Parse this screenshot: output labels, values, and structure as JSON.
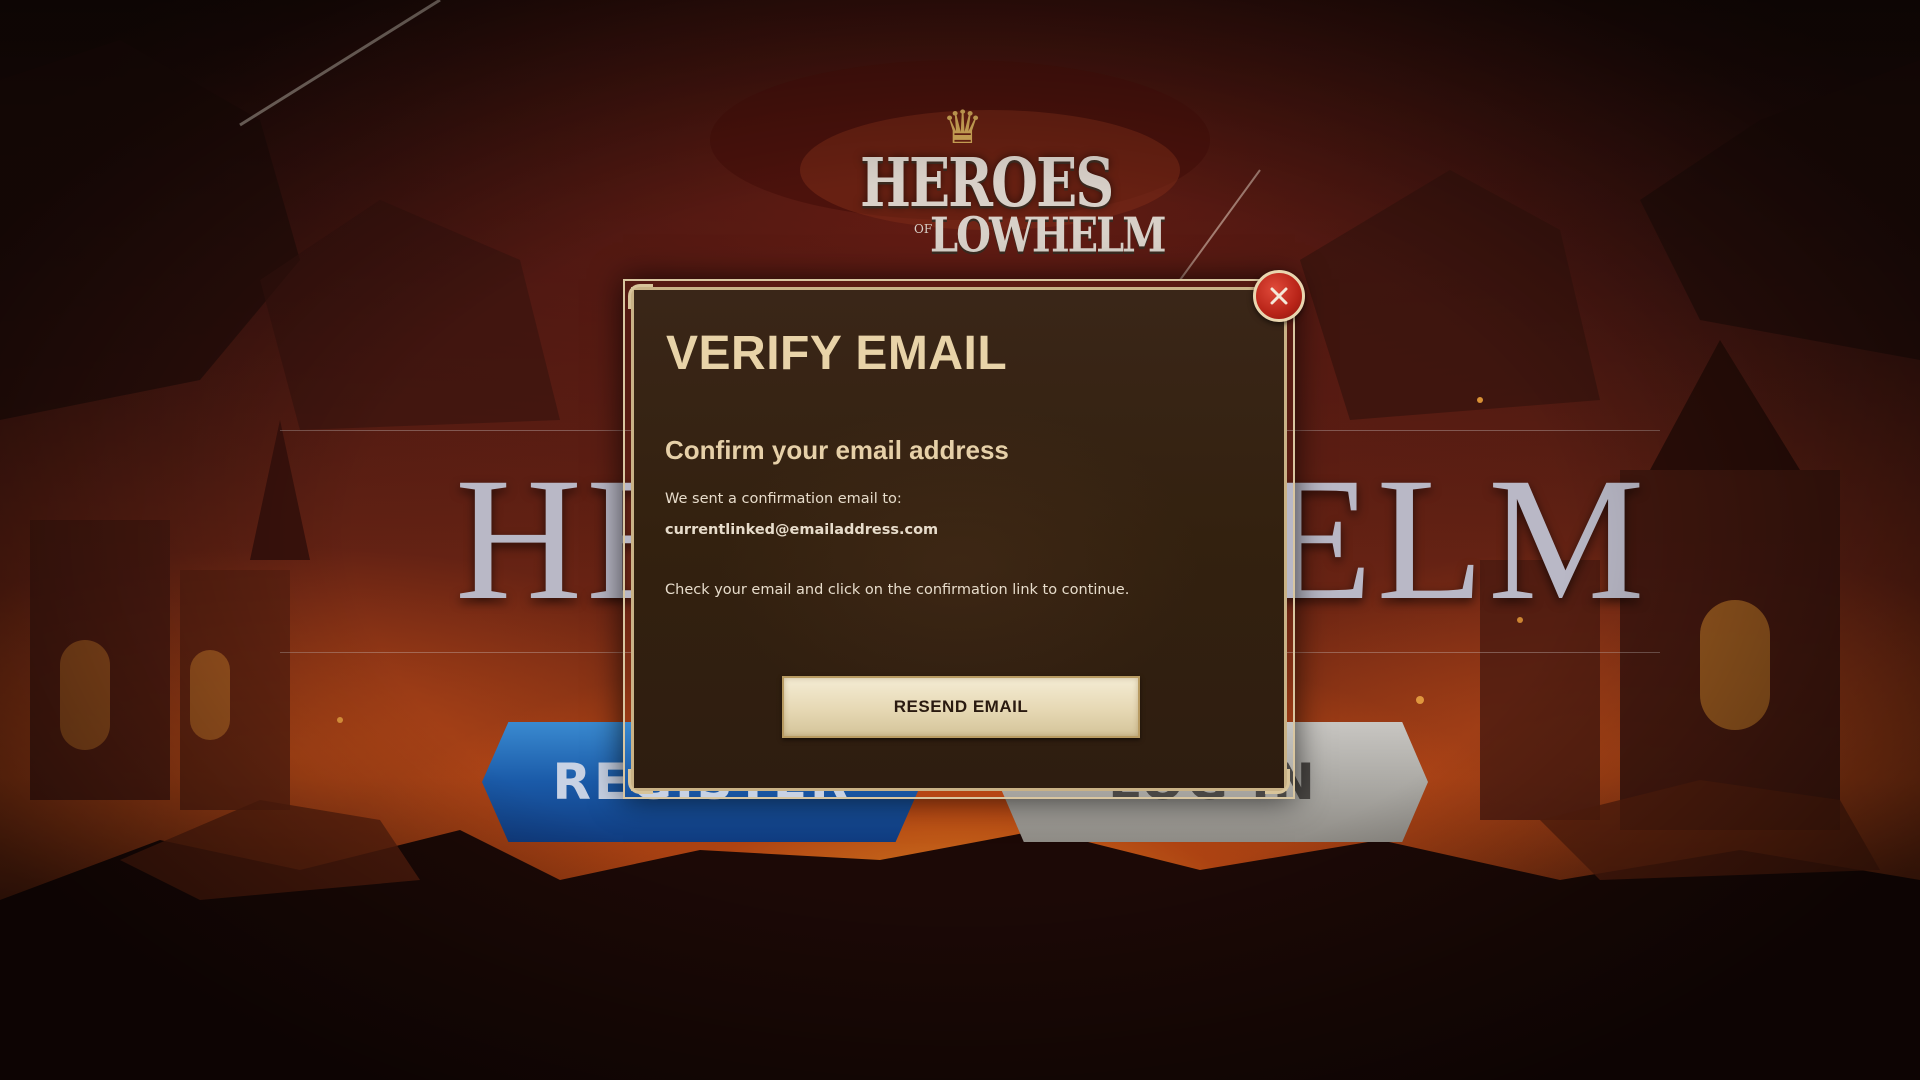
{
  "game": {
    "logo_line1": "HEROES",
    "logo_of": "OF",
    "logo_line2": "LOWHELM",
    "background_title_left": "HER",
    "background_title_right": "ELM"
  },
  "background_buttons": {
    "register_label": "REGISTER",
    "login_label": "LOG IN"
  },
  "modal": {
    "title": "VERIFY EMAIL",
    "subtitle": "Confirm your email address",
    "sent_text": "We sent a confirmation email to:",
    "email": "currentlinked@emailaddress.com",
    "instructions": "Check your email and click on the confirmation link to continue.",
    "resend_label": "RESEND EMAIL",
    "close_icon": "close-icon"
  },
  "colors": {
    "modal_bg": "#33210f",
    "modal_border": "#c9b286",
    "title_text": "#e8d3a8",
    "close_button": "#b82418",
    "register_button": "#1a5aa8",
    "login_button": "#a9a7a2"
  }
}
